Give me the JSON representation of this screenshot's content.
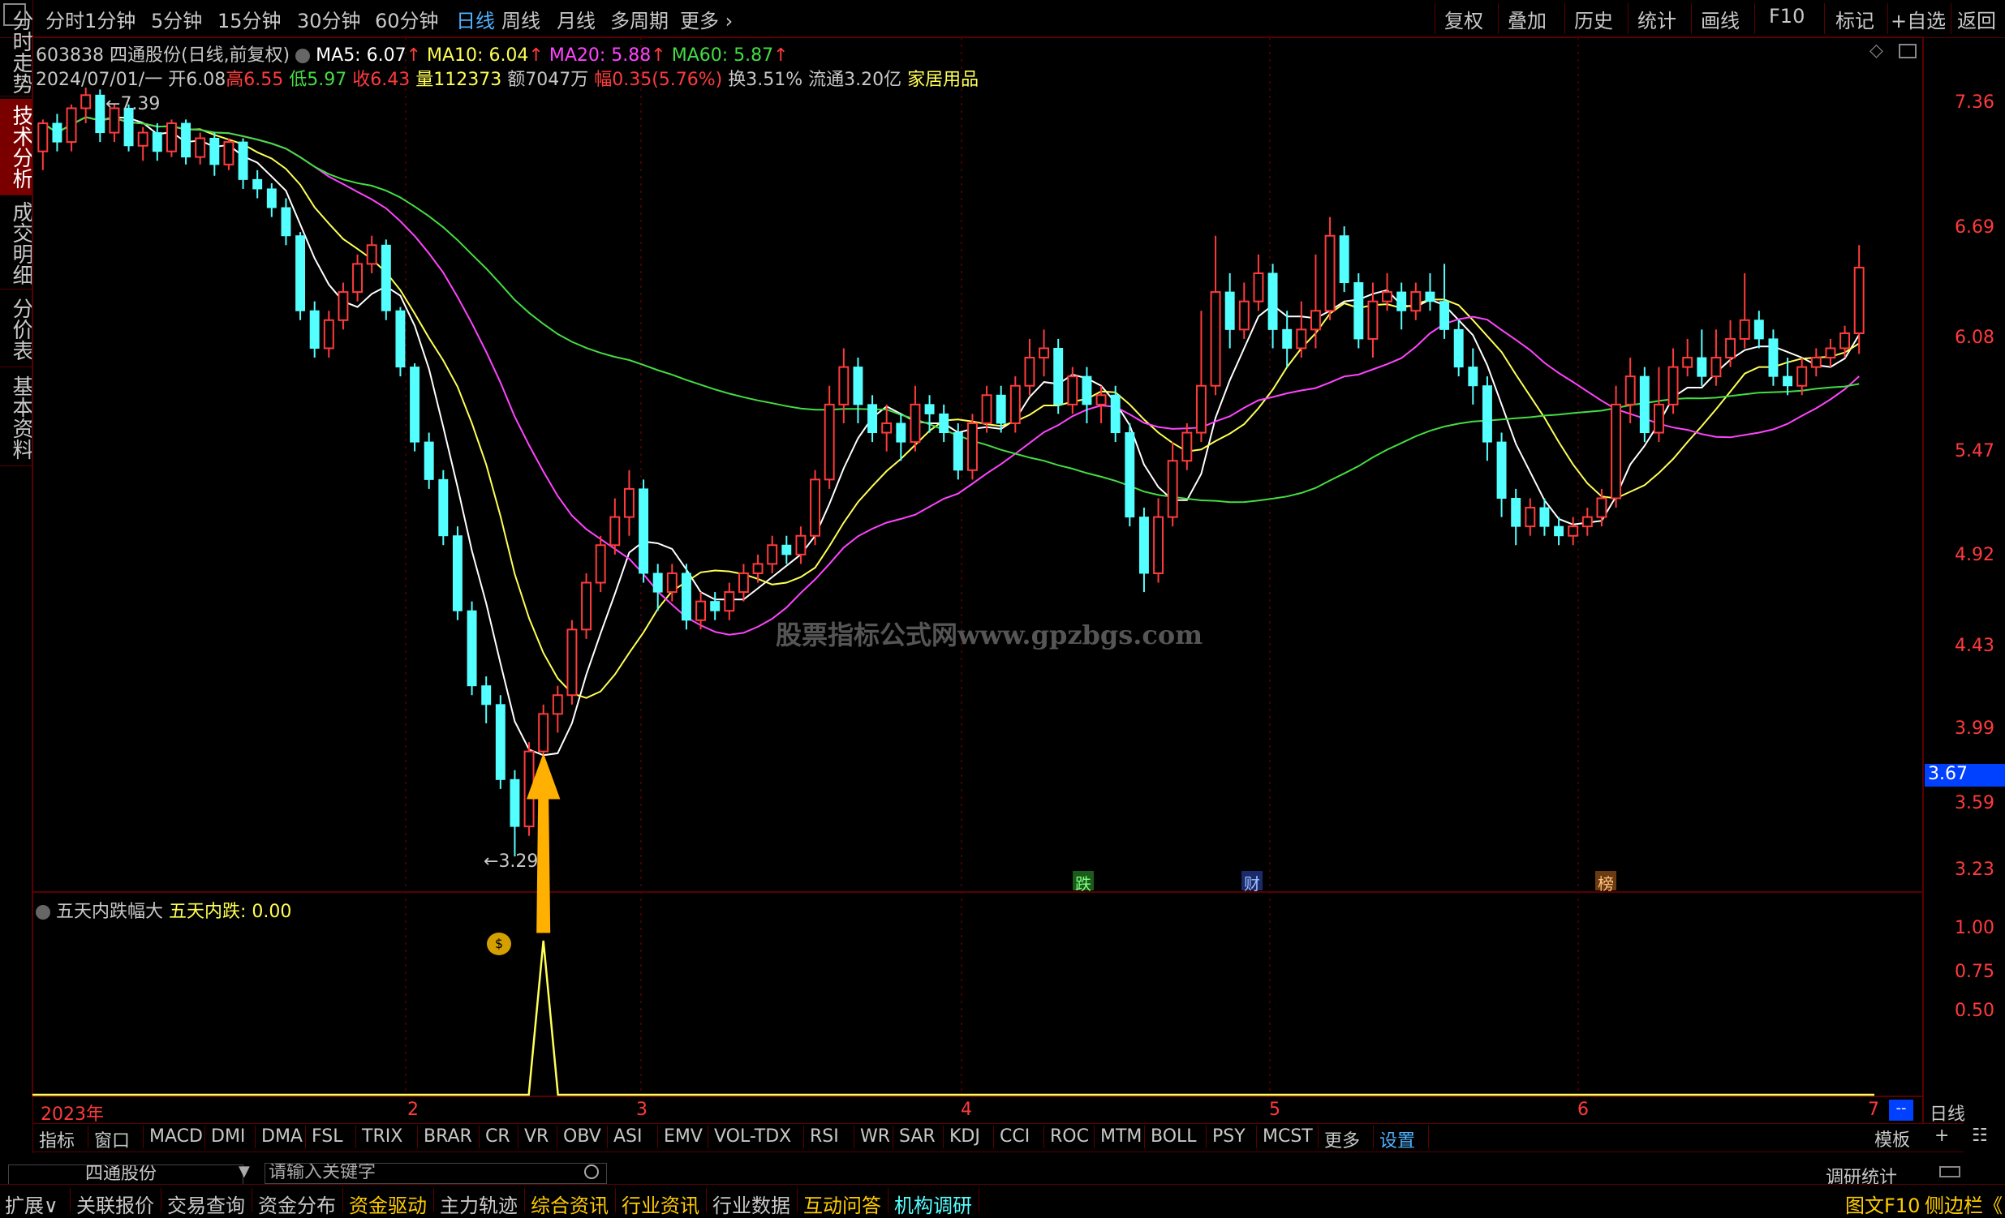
{
  "topbar": {
    "periods": [
      "分时",
      "1分钟",
      "5分钟",
      "15分钟",
      "30分钟",
      "60分钟",
      "日线",
      "周线",
      "月线",
      "多周期",
      "更多"
    ],
    "active_period": "日线",
    "right_buttons": [
      "复权",
      "叠加",
      "历史",
      "统计",
      "画线",
      "F10",
      "标记",
      "+自选",
      "返回"
    ]
  },
  "side_tabs": [
    "分时走势",
    "技术分析",
    "成交明细",
    "分价表",
    "基本资料"
  ],
  "stock": {
    "code": "603838",
    "name_line": "四通股份(日线,前复权)",
    "ma5": "MA5: 6.07",
    "ma10": "MA10: 6.04",
    "ma20": "MA20: 5.88",
    "ma60": "MA60: 5.87",
    "date": "2024/07/01/一",
    "open": "开6.08",
    "high": "高6.55",
    "low": "低5.97",
    "close": "收6.43",
    "vol": "量112373",
    "amount": "额7047万",
    "change": "幅0.35(5.76%)",
    "turnover": "换3.51%",
    "float": "流通3.20亿",
    "industry": "家居用品",
    "high_mark": "7.39",
    "low_mark": "3.29",
    "watermark": "股票指标公式网www.gpzbgs.com",
    "current_price": "3.67"
  },
  "price_axis": [
    "7.36",
    "6.69",
    "6.08",
    "5.47",
    "4.92",
    "4.43",
    "3.99",
    "3.59",
    "3.23"
  ],
  "sub_axis": [
    "1.00",
    "0.75",
    "0.50"
  ],
  "indicator": {
    "name": "五天内跌幅大",
    "value_label": "五天内跌: 0.00"
  },
  "markers": [
    "跌",
    "财",
    "榜"
  ],
  "time_axis": [
    "2023年",
    "2",
    "3",
    "4",
    "5",
    "6",
    "7"
  ],
  "period_box": "日线",
  "ind_tabs": [
    "指标",
    "窗口",
    "MACD",
    "DMI",
    "DMA",
    "FSL",
    "TRIX",
    "BRAR",
    "CR",
    "VR",
    "OBV",
    "ASI",
    "EMV",
    "VOL-TDX",
    "RSI",
    "WR",
    "SAR",
    "KDJ",
    "CCI",
    "ROC",
    "MTM",
    "BOLL",
    "PSY",
    "MCST",
    "更多",
    "设置"
  ],
  "template_btn": "模板",
  "search": {
    "stock_name": "四通股份",
    "placeholder": "请输入关键字"
  },
  "survey_label": "调研统计",
  "bottom_tabs": [
    "扩展∨",
    "关联报价",
    "交易查询",
    "资金分布",
    "资金驱动",
    "主力轨迹",
    "综合资讯",
    "行业资讯",
    "行业数据",
    "互动问答",
    "机构调研"
  ],
  "bottom_right": [
    "图文F10",
    "侧边栏《"
  ],
  "colors": {
    "up": "#ff3b3b",
    "down": "#54ffff",
    "ma5": "#ffffff",
    "ma10": "#ffff55",
    "ma20": "#ff44ff",
    "ma60": "#44dd44",
    "grid": "#5a0000"
  },
  "chart_data": {
    "type": "candlestick",
    "ylim": [
      3.23,
      7.36
    ],
    "candles": [
      [
        7.05,
        7.2,
        6.95,
        7.22
      ],
      [
        7.2,
        7.1,
        7.05,
        7.25
      ],
      [
        7.1,
        7.28,
        7.05,
        7.3
      ],
      [
        7.28,
        7.35,
        7.2,
        7.39
      ],
      [
        7.35,
        7.15,
        7.1,
        7.38
      ],
      [
        7.15,
        7.28,
        7.1,
        7.3
      ],
      [
        7.28,
        7.08,
        7.05,
        7.3
      ],
      [
        7.08,
        7.15,
        7.0,
        7.18
      ],
      [
        7.15,
        7.05,
        7.0,
        7.2
      ],
      [
        7.05,
        7.2,
        7.02,
        7.22
      ],
      [
        7.2,
        7.02,
        6.98,
        7.22
      ],
      [
        7.02,
        7.12,
        6.98,
        7.15
      ],
      [
        7.12,
        6.98,
        6.92,
        7.15
      ],
      [
        6.98,
        7.1,
        6.95,
        7.12
      ],
      [
        7.1,
        6.9,
        6.85,
        7.12
      ],
      [
        6.9,
        6.85,
        6.8,
        6.95
      ],
      [
        6.85,
        6.75,
        6.7,
        6.88
      ],
      [
        6.75,
        6.6,
        6.55,
        6.8
      ],
      [
        6.6,
        6.2,
        6.15,
        6.62
      ],
      [
        6.2,
        6.0,
        5.95,
        6.25
      ],
      [
        6.0,
        6.15,
        5.95,
        6.2
      ],
      [
        6.15,
        6.3,
        6.1,
        6.35
      ],
      [
        6.3,
        6.45,
        6.25,
        6.5
      ],
      [
        6.45,
        6.55,
        6.4,
        6.6
      ],
      [
        6.55,
        6.2,
        6.15,
        6.58
      ],
      [
        6.2,
        5.9,
        5.85,
        6.22
      ],
      [
        5.9,
        5.5,
        5.45,
        5.92
      ],
      [
        5.5,
        5.3,
        5.25,
        5.55
      ],
      [
        5.3,
        5.0,
        4.95,
        5.35
      ],
      [
        5.0,
        4.6,
        4.55,
        5.05
      ],
      [
        4.6,
        4.2,
        4.15,
        4.65
      ],
      [
        4.2,
        4.1,
        4.0,
        4.25
      ],
      [
        4.1,
        3.7,
        3.65,
        4.15
      ],
      [
        3.7,
        3.45,
        3.29,
        3.75
      ],
      [
        3.45,
        3.85,
        3.4,
        3.9
      ],
      [
        3.85,
        4.05,
        3.8,
        4.1
      ],
      [
        4.05,
        4.15,
        3.95,
        4.2
      ],
      [
        4.15,
        4.5,
        4.1,
        4.55
      ],
      [
        4.5,
        4.75,
        4.45,
        4.8
      ],
      [
        4.75,
        4.95,
        4.7,
        5.0
      ],
      [
        4.95,
        5.1,
        4.9,
        5.2
      ],
      [
        5.1,
        5.25,
        5.0,
        5.35
      ],
      [
        5.25,
        4.8,
        4.75,
        5.3
      ],
      [
        4.8,
        4.7,
        4.6,
        4.85
      ],
      [
        4.7,
        4.8,
        4.65,
        4.85
      ],
      [
        4.8,
        4.55,
        4.5,
        4.85
      ],
      [
        4.55,
        4.65,
        4.5,
        4.7
      ],
      [
        4.65,
        4.6,
        4.55,
        4.7
      ],
      [
        4.6,
        4.7,
        4.55,
        4.75
      ],
      [
        4.7,
        4.8,
        4.65,
        4.85
      ],
      [
        4.8,
        4.85,
        4.75,
        4.9
      ],
      [
        4.85,
        4.95,
        4.8,
        5.0
      ],
      [
        4.95,
        4.9,
        4.85,
        5.0
      ],
      [
        4.9,
        5.0,
        4.85,
        5.05
      ],
      [
        5.0,
        5.3,
        4.95,
        5.35
      ],
      [
        5.3,
        5.7,
        5.25,
        5.8
      ],
      [
        5.7,
        5.9,
        5.6,
        6.0
      ],
      [
        5.9,
        5.7,
        5.6,
        5.95
      ],
      [
        5.7,
        5.55,
        5.5,
        5.75
      ],
      [
        5.55,
        5.6,
        5.45,
        5.7
      ],
      [
        5.6,
        5.5,
        5.4,
        5.65
      ],
      [
        5.5,
        5.7,
        5.45,
        5.8
      ],
      [
        5.7,
        5.65,
        5.55,
        5.75
      ],
      [
        5.65,
        5.55,
        5.5,
        5.7
      ],
      [
        5.55,
        5.35,
        5.3,
        5.6
      ],
      [
        5.35,
        5.6,
        5.3,
        5.65
      ],
      [
        5.6,
        5.75,
        5.55,
        5.8
      ],
      [
        5.75,
        5.6,
        5.55,
        5.8
      ],
      [
        5.6,
        5.8,
        5.55,
        5.85
      ],
      [
        5.8,
        5.95,
        5.75,
        6.05
      ],
      [
        5.95,
        6.0,
        5.85,
        6.1
      ],
      [
        6.0,
        5.7,
        5.65,
        6.05
      ],
      [
        5.7,
        5.85,
        5.65,
        5.9
      ],
      [
        5.85,
        5.7,
        5.6,
        5.9
      ],
      [
        5.7,
        5.75,
        5.6,
        5.8
      ],
      [
        5.75,
        5.55,
        5.5,
        5.8
      ],
      [
        5.55,
        5.1,
        5.05,
        5.6
      ],
      [
        5.1,
        4.8,
        4.7,
        5.15
      ],
      [
        4.8,
        5.1,
        4.75,
        5.2
      ],
      [
        5.1,
        5.4,
        5.05,
        5.5
      ],
      [
        5.4,
        5.55,
        5.35,
        5.6
      ],
      [
        5.55,
        5.8,
        5.5,
        6.2
      ],
      [
        5.8,
        6.3,
        5.75,
        6.6
      ],
      [
        6.3,
        6.1,
        6.0,
        6.4
      ],
      [
        6.1,
        6.25,
        6.05,
        6.35
      ],
      [
        6.25,
        6.4,
        6.2,
        6.5
      ],
      [
        6.4,
        6.1,
        6.0,
        6.45
      ],
      [
        6.1,
        6.0,
        5.9,
        6.2
      ],
      [
        6.0,
        6.1,
        5.95,
        6.25
      ],
      [
        6.1,
        6.2,
        6.0,
        6.5
      ],
      [
        6.2,
        6.6,
        6.15,
        6.7
      ],
      [
        6.6,
        6.35,
        6.3,
        6.65
      ],
      [
        6.35,
        6.05,
        6.0,
        6.4
      ],
      [
        6.05,
        6.25,
        5.95,
        6.35
      ],
      [
        6.25,
        6.3,
        6.2,
        6.4
      ],
      [
        6.3,
        6.2,
        6.1,
        6.35
      ],
      [
        6.2,
        6.3,
        6.15,
        6.35
      ],
      [
        6.3,
        6.25,
        6.2,
        6.4
      ],
      [
        6.25,
        6.1,
        6.05,
        6.45
      ],
      [
        6.1,
        5.9,
        5.85,
        6.15
      ],
      [
        5.9,
        5.8,
        5.7,
        6.0
      ],
      [
        5.8,
        5.5,
        5.4,
        5.85
      ],
      [
        5.5,
        5.2,
        5.1,
        5.55
      ],
      [
        5.2,
        5.05,
        4.95,
        5.25
      ],
      [
        5.05,
        5.15,
        5.0,
        5.2
      ],
      [
        5.15,
        5.05,
        5.0,
        5.2
      ],
      [
        5.05,
        5.0,
        4.95,
        5.1
      ],
      [
        5.0,
        5.05,
        4.95,
        5.1
      ],
      [
        5.05,
        5.1,
        5.0,
        5.15
      ],
      [
        5.1,
        5.2,
        5.05,
        5.25
      ],
      [
        5.2,
        5.7,
        5.15,
        5.8
      ],
      [
        5.7,
        5.85,
        5.6,
        5.95
      ],
      [
        5.85,
        5.55,
        5.5,
        5.9
      ],
      [
        5.55,
        5.7,
        5.5,
        5.9
      ],
      [
        5.7,
        5.9,
        5.65,
        6.0
      ],
      [
        5.9,
        5.95,
        5.85,
        6.05
      ],
      [
        5.95,
        5.85,
        5.8,
        6.1
      ],
      [
        5.85,
        5.95,
        5.8,
        6.1
      ],
      [
        5.95,
        6.05,
        5.9,
        6.15
      ],
      [
        6.05,
        6.15,
        6.0,
        6.4
      ],
      [
        6.15,
        6.05,
        6.0,
        6.2
      ],
      [
        6.05,
        5.85,
        5.8,
        6.1
      ],
      [
        5.85,
        5.8,
        5.75,
        5.95
      ],
      [
        5.8,
        5.9,
        5.75,
        5.95
      ],
      [
        5.9,
        5.95,
        5.85,
        6.0
      ],
      [
        5.95,
        6.0,
        5.9,
        6.05
      ],
      [
        6.0,
        6.08,
        5.95,
        6.12
      ],
      [
        6.08,
        6.43,
        5.97,
        6.55
      ]
    ],
    "signal_index": 35
  }
}
